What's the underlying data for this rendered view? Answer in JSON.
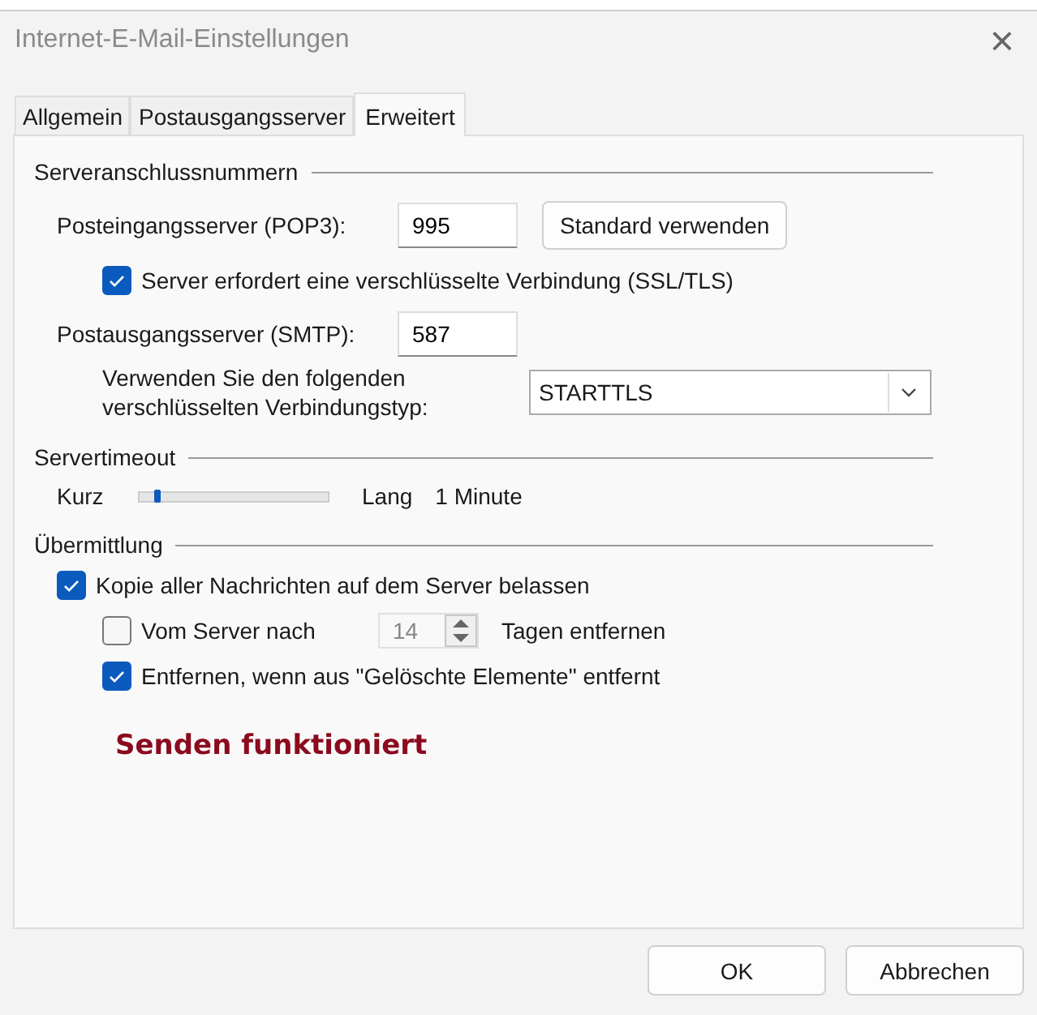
{
  "window": {
    "title": "Internet-E-Mail-Einstellungen",
    "close": "×"
  },
  "tabs": [
    {
      "label": "Allgemein",
      "selected": false
    },
    {
      "label": "Postausgangsserver",
      "selected": false
    },
    {
      "label": "Erweitert",
      "selected": true
    }
  ],
  "server_ports": {
    "heading": "Serveranschlussnummern",
    "incoming": {
      "label": "Posteingangsserver (POP3):",
      "value": "995"
    },
    "default_button": "Standard verwenden",
    "ssl": {
      "label": "Server erfordert eine verschlüsselte Verbindung (SSL/TLS)",
      "checked": true
    },
    "outgoing": {
      "label": "Postausgangsserver (SMTP):",
      "value": "587"
    },
    "encryption": {
      "label": "Verwenden Sie den folgenden verschlüsselten Verbindungstyp:",
      "value": "STARTTLS"
    }
  },
  "timeout": {
    "heading": "Servertimeout",
    "min_label": "Kurz",
    "max_label": "Lang",
    "level": 0.08,
    "reading": "1 Minute"
  },
  "delivery": {
    "heading": "Übermittlung",
    "keep_copy": {
      "label": "Kopie aller Nachrichten auf dem Server belassen",
      "checked": true
    },
    "remove_after": {
      "label": "Vom Server nach",
      "checked": false,
      "value": "14",
      "suffix": "Tagen entfernen",
      "disabled": true
    },
    "remove_deleted": {
      "label": "Entfernen, wenn aus \"Gelöschte Elemente\" entfernt",
      "checked": true
    }
  },
  "note": "Senden funktioniert",
  "buttons": [
    "OK",
    "Abbrechen"
  ]
}
